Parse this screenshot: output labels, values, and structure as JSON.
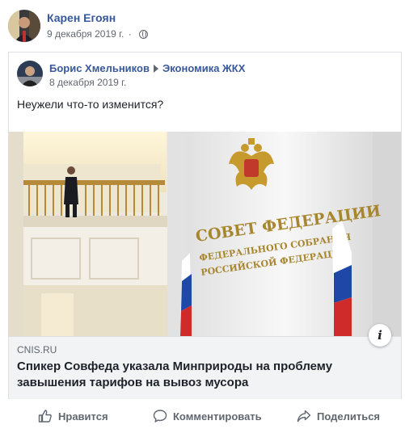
{
  "post": {
    "author": "Карен Егоян",
    "date": "9 декабря 2019 г.",
    "separator": "·",
    "privacy_icon": "globe-icon"
  },
  "shared_post": {
    "author": "Борис Хмельников",
    "group": "Экономика ЖКХ",
    "date": "8 декабря 2019 г.",
    "text": "Неужели что-то изменится?",
    "link": {
      "image_sign_line1": "СОВЕТ ФЕДЕРАЦИИ",
      "image_sign_line2": "ФЕДЕРАЛЬНОГО СОБРАНИЯ",
      "image_sign_line3": "РОССИЙСКОЙ ФЕДЕРАЦИИ",
      "domain": "CNIS.RU",
      "headline": "Спикер Совфеда указала Минприроды на проблему завышения тарифов на вывоз мусора",
      "info_icon": "info-icon"
    }
  },
  "actions": {
    "like": "Нравится",
    "comment": "Комментировать",
    "share": "Поделиться"
  },
  "colors": {
    "link_blue": "#385898",
    "meta_gray": "#616770",
    "info_bg": "#f2f3f5"
  }
}
